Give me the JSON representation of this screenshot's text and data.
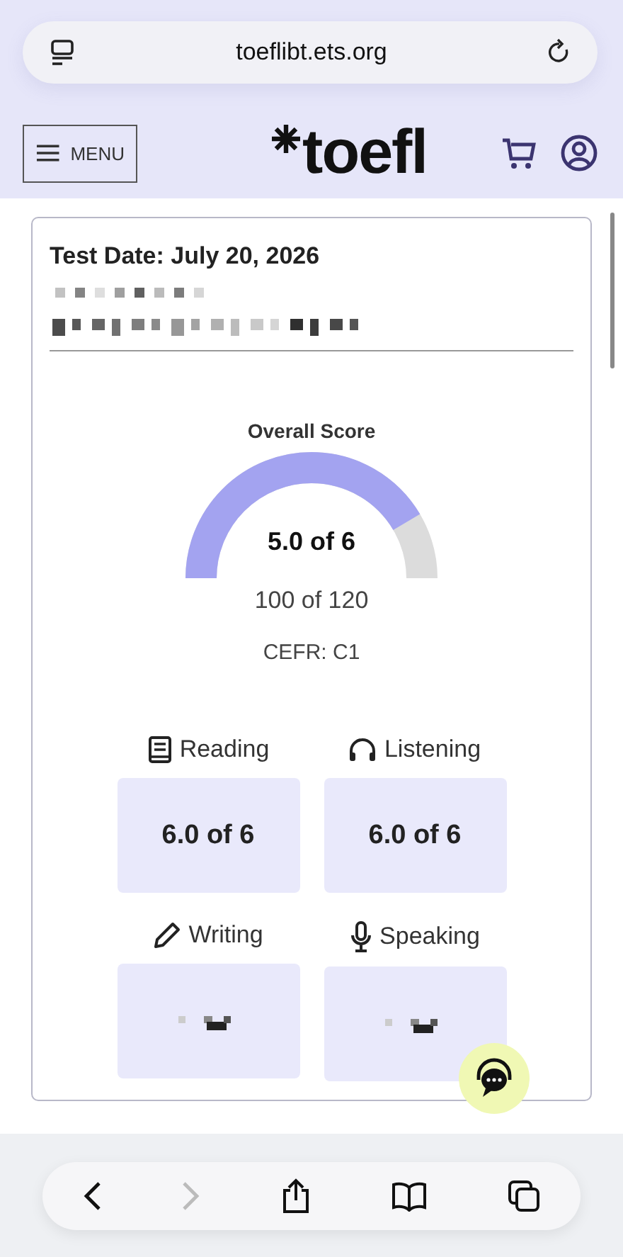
{
  "browser": {
    "url": "toeflibt.ets.org"
  },
  "header": {
    "menu_label": "MENU",
    "logo": "toefl"
  },
  "card": {
    "test_date": "Test Date: July 20, 2026",
    "overall": {
      "title": "Overall Score",
      "score": "5.0 of 6",
      "total": "100 of 120",
      "cefr": "CEFR: C1"
    },
    "sections": [
      {
        "kind": "reading",
        "label": "Reading",
        "score": "6.0 of 6"
      },
      {
        "kind": "listening",
        "label": "Listening",
        "score": "6.0 of 6"
      },
      {
        "kind": "writing",
        "label": "Writing"
      },
      {
        "kind": "speaking",
        "label": "Speaking"
      }
    ]
  },
  "toolbar": {
    "back": {
      "disabled": false
    },
    "forward": {
      "disabled": true
    }
  }
}
